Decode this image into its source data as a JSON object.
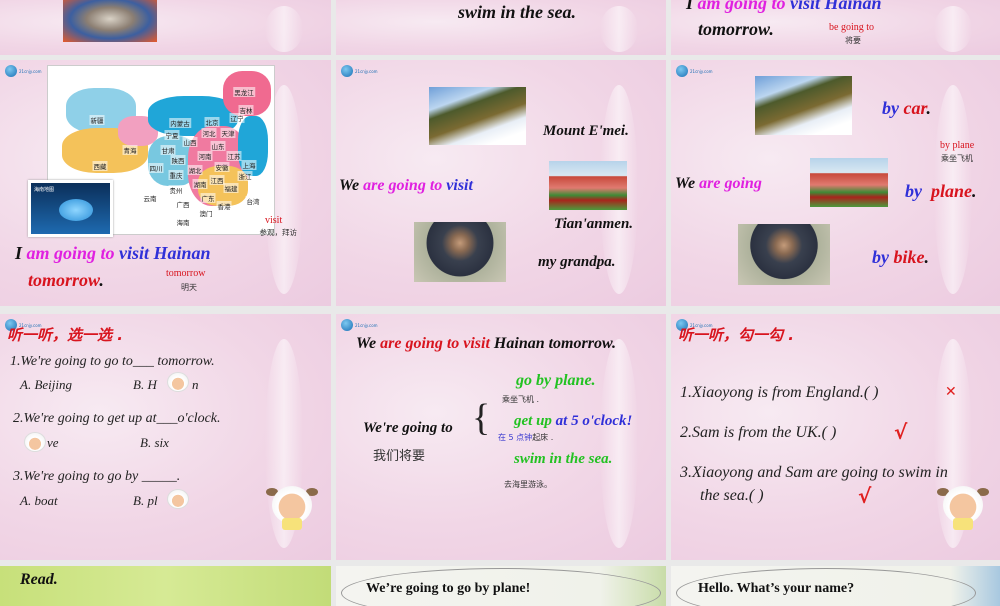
{
  "slides": {
    "row1_col2": {
      "text": "swim in the sea."
    },
    "row1_col3": {
      "line1": {
        "i": "I",
        "am_going_to": "am going to",
        "visit_hainan": "visit Hainan"
      },
      "line2": "tomorrow.",
      "note": "be going to",
      "note_zh": "将要"
    },
    "map_slide": {
      "provinces": [
        "新疆",
        "西藏",
        "青海",
        "甘肃",
        "内蒙古",
        "宁夏",
        "陕西",
        "山西",
        "北京",
        "河北",
        "天津",
        "辽宁",
        "吉林",
        "黑龙江",
        "山东",
        "河南",
        "江苏",
        "上海",
        "安徽",
        "湖北",
        "四川",
        "重庆",
        "贵州",
        "云南",
        "广西",
        "湖南",
        "江西",
        "浙江",
        "福建",
        "广东",
        "香港",
        "澳门",
        "台湾",
        "海南"
      ],
      "inset_title": "海南地图",
      "vocab_visit": "visit",
      "vocab_visit_zh": "参观，拜访",
      "sentence": {
        "i": "I",
        "am_going_to": "am going to",
        "visit_hainan": "visit Hainan",
        "tomorrow": "tomorrow",
        "period": "."
      },
      "vocab_tomorrow": "tomorrow",
      "vocab_tomorrow_zh": "明天"
    },
    "visit_slide": {
      "we": "We",
      "are_going_to": "are going to",
      "visit": "visit",
      "place1": "Mount E'mei.",
      "place2": "Tian'anmen.",
      "place3": "my grandpa."
    },
    "transport_slide": {
      "we": "We",
      "are_going": "are going",
      "by": "by",
      "car": "car",
      "plane": "plane",
      "bike": "bike",
      "period": ".",
      "note": "by plane",
      "note_zh": "乘坐飞机"
    },
    "quiz_select": {
      "title": "听一听，选一选 .",
      "q1": "1.We're going to go to___ tomorrow.",
      "q1_a": "A. Beijing",
      "q1_b_pre": "B.  H",
      "q1_b_post": "n",
      "q2": "2.We're going to get up at___o'clock.",
      "q2_a_post": "ve",
      "q2_b": "B. six",
      "q3": "3.We're going to go by _____.",
      "q3_a": "A. boat",
      "q3_b_pre": "B. pl"
    },
    "plan_slide": {
      "headline": {
        "we": "We",
        "are_going_to_visit": "are going to visit",
        "rest": "Hainan tomorrow."
      },
      "stem": "We're going to",
      "stem_zh": "我们将要",
      "brace": "{",
      "opt1": "go  by  plane.",
      "opt1_zh": "乘坐飞机 .",
      "opt2_a": "get up",
      "opt2_b": " at 5 o'clock!",
      "opt2_zh_a": "在 5 点钟",
      "opt2_zh_b": "起床 .",
      "opt3": "swim in the sea.",
      "opt3_zh": "去海里游泳。"
    },
    "quiz_check": {
      "title": "听一听，勾一勾 .",
      "s1": "1.Xiaoyong is from England.(    )",
      "s1_mark": "✕",
      "s2": "2.Sam is from the UK.(    )",
      "s2_mark": "√",
      "s3a": "3.Xiaoyong and Sam are going to swim in",
      "s3b": "the sea.(    )",
      "s3_mark": "√"
    },
    "row4_col1": {
      "text": "Read."
    },
    "row4_col2": {
      "text": "We’re  going  to  go  by  plane!"
    },
    "row4_col3": {
      "text": "Hello.  What’s  your  name?"
    }
  },
  "colors": {
    "magenta": "#e020e0",
    "blue": "#3030d8",
    "red": "#d8141e",
    "green": "#22c222",
    "background": "#e9e9e9"
  }
}
